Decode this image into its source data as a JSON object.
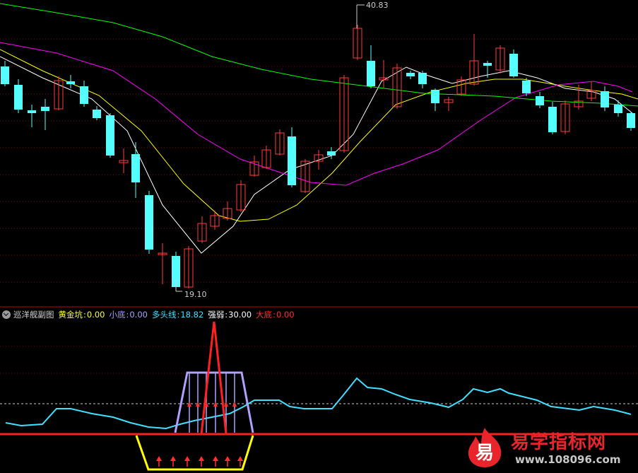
{
  "price_labels": {
    "high": "40.83",
    "low": "19.10"
  },
  "indicator": {
    "name": "巡洋舰副图",
    "items": [
      {
        "label": "黄金坑",
        "sep": ": ",
        "value": "0.00",
        "label_color": "#ffff40",
        "value_color": "#ffff40"
      },
      {
        "label": "小底",
        "sep": ": ",
        "value": "0.00",
        "label_color": "#b0a0ff",
        "value_color": "#b0a0ff"
      },
      {
        "label": "多头线",
        "sep": ": ",
        "value": "18.82",
        "label_color": "#40e0ff",
        "value_color": "#40e0ff"
      },
      {
        "label": "强弱",
        "sep": ": ",
        "value": "30.00",
        "label_color": "#ffffff",
        "value_color": "#ffffff"
      },
      {
        "label": "大底",
        "sep": ": ",
        "value": "0.00",
        "label_color": "#ff3030",
        "value_color": "#ff3030"
      }
    ]
  },
  "watermark": {
    "brand": "易学指标网",
    "url": "www.108096.com",
    "glyph": "易"
  },
  "colors": {
    "up": "#ff3c3c",
    "down": "#54ffff",
    "ma_white": "#ffffff",
    "ma_yellow": "#ffff00",
    "ma_magenta": "#ff00ff",
    "ma_green": "#00ff00",
    "grid": "#8b0000"
  }
}
